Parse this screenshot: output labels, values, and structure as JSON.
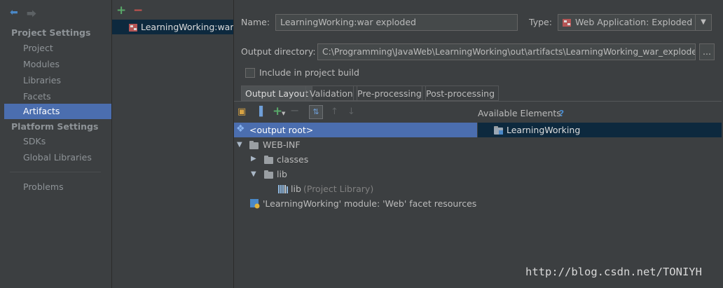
{
  "nav": {
    "project_settings": "Project Settings",
    "items_project": [
      "Project",
      "Modules",
      "Libraries",
      "Facets",
      "Artifacts"
    ],
    "platform_settings": "Platform Settings",
    "items_platform": [
      "SDKs",
      "Global Libraries"
    ],
    "problems": "Problems",
    "selected": "Artifacts"
  },
  "artifact_list": {
    "items": [
      "LearningWorking:war exploded"
    ]
  },
  "form": {
    "name_label": "Name:",
    "name_value": "LearningWorking:war exploded",
    "type_label": "Type:",
    "type_value": "Web Application: Exploded",
    "output_dir_label": "Output directory:",
    "output_dir_value": "C:\\Programming\\JavaWeb\\LearningWorking\\out\\artifacts\\LearningWorking_war_exploded",
    "browse_label": "...",
    "include_build_label": "Include in project build",
    "include_build_checked": false
  },
  "tabs": [
    "Output Layout",
    "Validation",
    "Pre-processing",
    "Post-processing"
  ],
  "active_tab": "Output Layout",
  "layout_tree": [
    {
      "label": "<output root>",
      "kind": "root"
    },
    {
      "label": "WEB-INF",
      "kind": "folder"
    },
    {
      "label": "classes",
      "kind": "folder"
    },
    {
      "label": "lib",
      "kind": "folder"
    },
    {
      "label": "lib",
      "suffix": "(Project Library)",
      "kind": "library"
    },
    {
      "label": "'LearningWorking' module: 'Web' facet resources",
      "kind": "facet"
    }
  ],
  "available": {
    "title": "Available Elements",
    "help": "?",
    "items": [
      "LearningWorking"
    ]
  },
  "watermark": "http://blog.csdn.net/TONIYH",
  "colors": {
    "selection_blue": "#4b6eaf",
    "selection_dark": "#0d293e",
    "add_green": "#59a869",
    "remove_red": "#c75450"
  }
}
